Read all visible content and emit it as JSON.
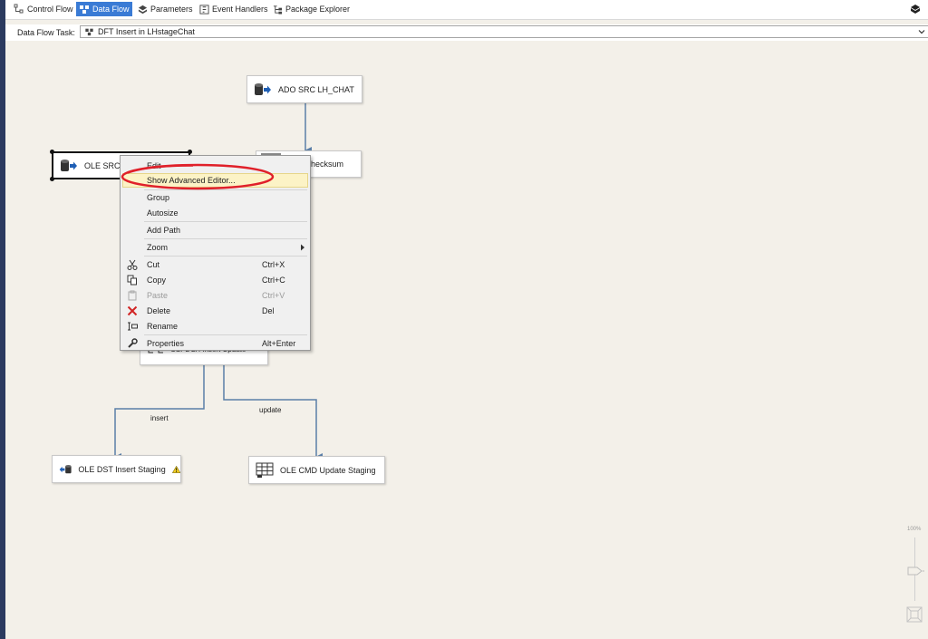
{
  "tabs": [
    {
      "label": "Control Flow",
      "icon": "control-flow-icon"
    },
    {
      "label": "Data Flow",
      "icon": "data-flow-icon",
      "active": true
    },
    {
      "label": "Parameters",
      "icon": "parameters-icon"
    },
    {
      "label": "Event Handlers",
      "icon": "event-handlers-icon"
    },
    {
      "label": "Package Explorer",
      "icon": "package-explorer-icon"
    }
  ],
  "task_bar": {
    "label": "Data Flow Task:",
    "selected": "DFT Insert in LHstageChat"
  },
  "nodes": {
    "ado_src": "ADO SRC LH_CHAT",
    "ole_src": "OLE SRC E",
    "checksum": "hecksum",
    "csplit": "CSPL LH Insert Update",
    "ole_dst": "OLE DST Insert Staging",
    "ole_cmd": "OLE CMD Update Staging"
  },
  "paths": {
    "insert": "insert",
    "update": "update"
  },
  "context_menu": [
    {
      "label": "Edit",
      "shortcut": "",
      "icon": ""
    },
    {
      "label": "Show Advanced Editor...",
      "shortcut": "",
      "icon": "",
      "highlighted": true
    },
    {
      "label": "Group",
      "shortcut": "",
      "icon": ""
    },
    {
      "label": "Autosize",
      "shortcut": "",
      "icon": ""
    },
    {
      "label": "Add Path",
      "shortcut": "",
      "icon": ""
    },
    {
      "label": "Zoom",
      "shortcut": "",
      "icon": "",
      "submenu": true
    },
    {
      "label": "Cut",
      "shortcut": "Ctrl+X",
      "icon": "scissors-icon"
    },
    {
      "label": "Copy",
      "shortcut": "Ctrl+C",
      "icon": "copy-icon"
    },
    {
      "label": "Paste",
      "shortcut": "Ctrl+V",
      "icon": "paste-icon",
      "disabled": true
    },
    {
      "label": "Delete",
      "shortcut": "Del",
      "icon": "delete-x-icon"
    },
    {
      "label": "Rename",
      "shortcut": "",
      "icon": "rename-icon"
    },
    {
      "label": "Properties",
      "shortcut": "Alt+Enter",
      "icon": "wrench-icon"
    }
  ],
  "zoom": {
    "label": "100%",
    "level_percent": 100
  },
  "colors": {
    "accent": "#3a7bd5",
    "highlight": "#fcf3c6",
    "annotation": "#e0202a",
    "connector": "#5b7fa8"
  }
}
